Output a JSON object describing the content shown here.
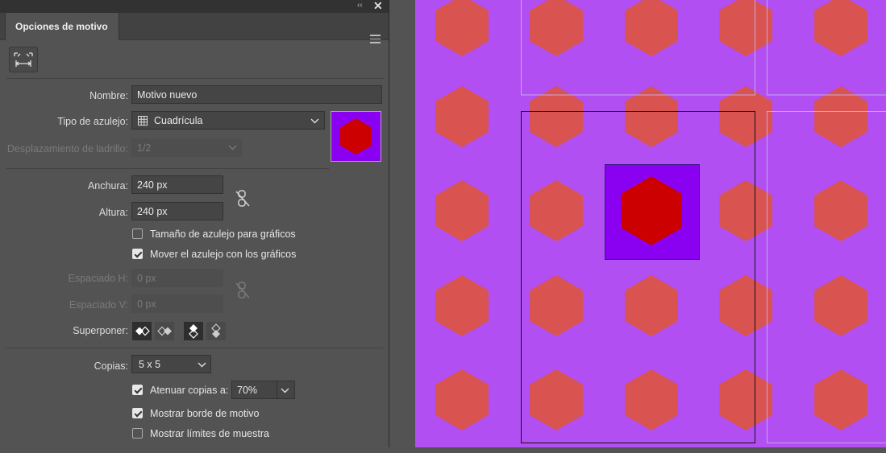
{
  "panel": {
    "tab_title": "Opciones de motivo",
    "menu_icon": "hamburger-menu-icon",
    "collapse_icon": "double-chevron-left-icon",
    "close_icon": "close-icon",
    "tool_icon": "fit-tile-to-artwork-icon"
  },
  "form": {
    "name_label": "Nombre:",
    "name_value": "Motivo nuevo",
    "tile_type_label": "Tipo de azulejo:",
    "tile_type_value": "Cuadrícula",
    "brick_offset_label": "Desplazamiento de ladrillo:",
    "brick_offset_value": "1/2",
    "width_label": "Anchura:",
    "width_value": "240 px",
    "height_label": "Altura:",
    "height_value": "240 px",
    "size_tile_label": "Tamaño de azulejo para gráficos",
    "size_tile_checked": false,
    "move_tile_label": "Mover el azulejo con los gráficos",
    "move_tile_checked": true,
    "h_spacing_label": "Espaciado H:",
    "h_spacing_value": "0 px",
    "v_spacing_label": "Espaciado V:",
    "v_spacing_value": "0 px",
    "overlap_label": "Superponer:",
    "copies_label": "Copias:",
    "copies_value": "5 x 5",
    "dim_copies_label": "Atenuar copias a:",
    "dim_copies_checked": true,
    "dim_copies_value": "70%",
    "show_edge_label": "Mostrar borde de motivo",
    "show_edge_checked": true,
    "show_bounds_label": "Mostrar límites de muestra",
    "show_bounds_checked": false
  },
  "colors": {
    "canvas_bg": "#b14ff2",
    "tile_bg": "#8a00f0",
    "hexagon_main": "#cc0000",
    "hexagon_dimmed": "#d95350"
  }
}
